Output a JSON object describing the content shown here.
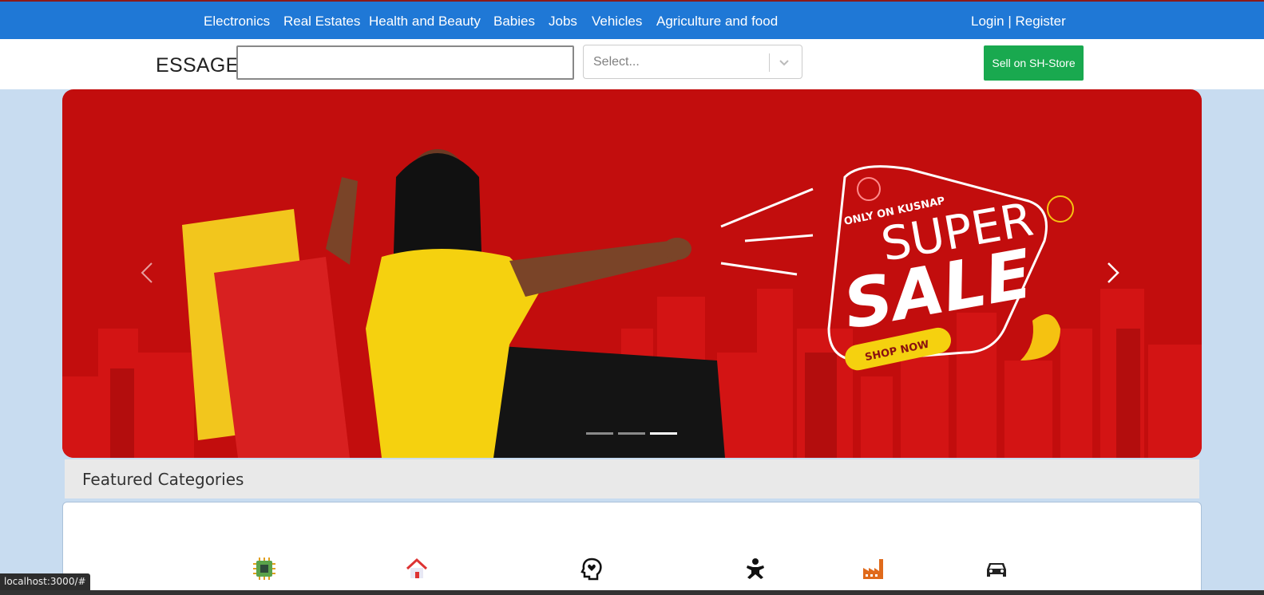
{
  "nav": {
    "links": [
      "Electronics",
      "Real Estates",
      "Health and Beauty",
      "Babies",
      "Jobs",
      "Vehicles",
      "Agriculture and food"
    ],
    "auth": "Login | Register"
  },
  "header": {
    "brand": "ESSAGE",
    "search_value": "",
    "select_placeholder": "Select...",
    "sell_button": "Sell on SH-Store"
  },
  "carousel": {
    "slide_text": {
      "tagline": "ONLY ON KUSNAP",
      "headline1": "SUPER",
      "headline2": "SALE",
      "cta": "SHOP NOW"
    },
    "slide_count": 3,
    "active_index": 2
  },
  "featured": {
    "title": "Featured Categories",
    "icons": [
      "chip-icon",
      "house-icon",
      "head-heart-icon",
      "baby-icon",
      "factory-icon",
      "car-icon"
    ]
  },
  "status_bar": "localhost:3000/#",
  "colors": {
    "nav_bg": "#1f78d6",
    "banner_bg": "#c20d0d",
    "sell_button_bg": "#19a94f"
  }
}
